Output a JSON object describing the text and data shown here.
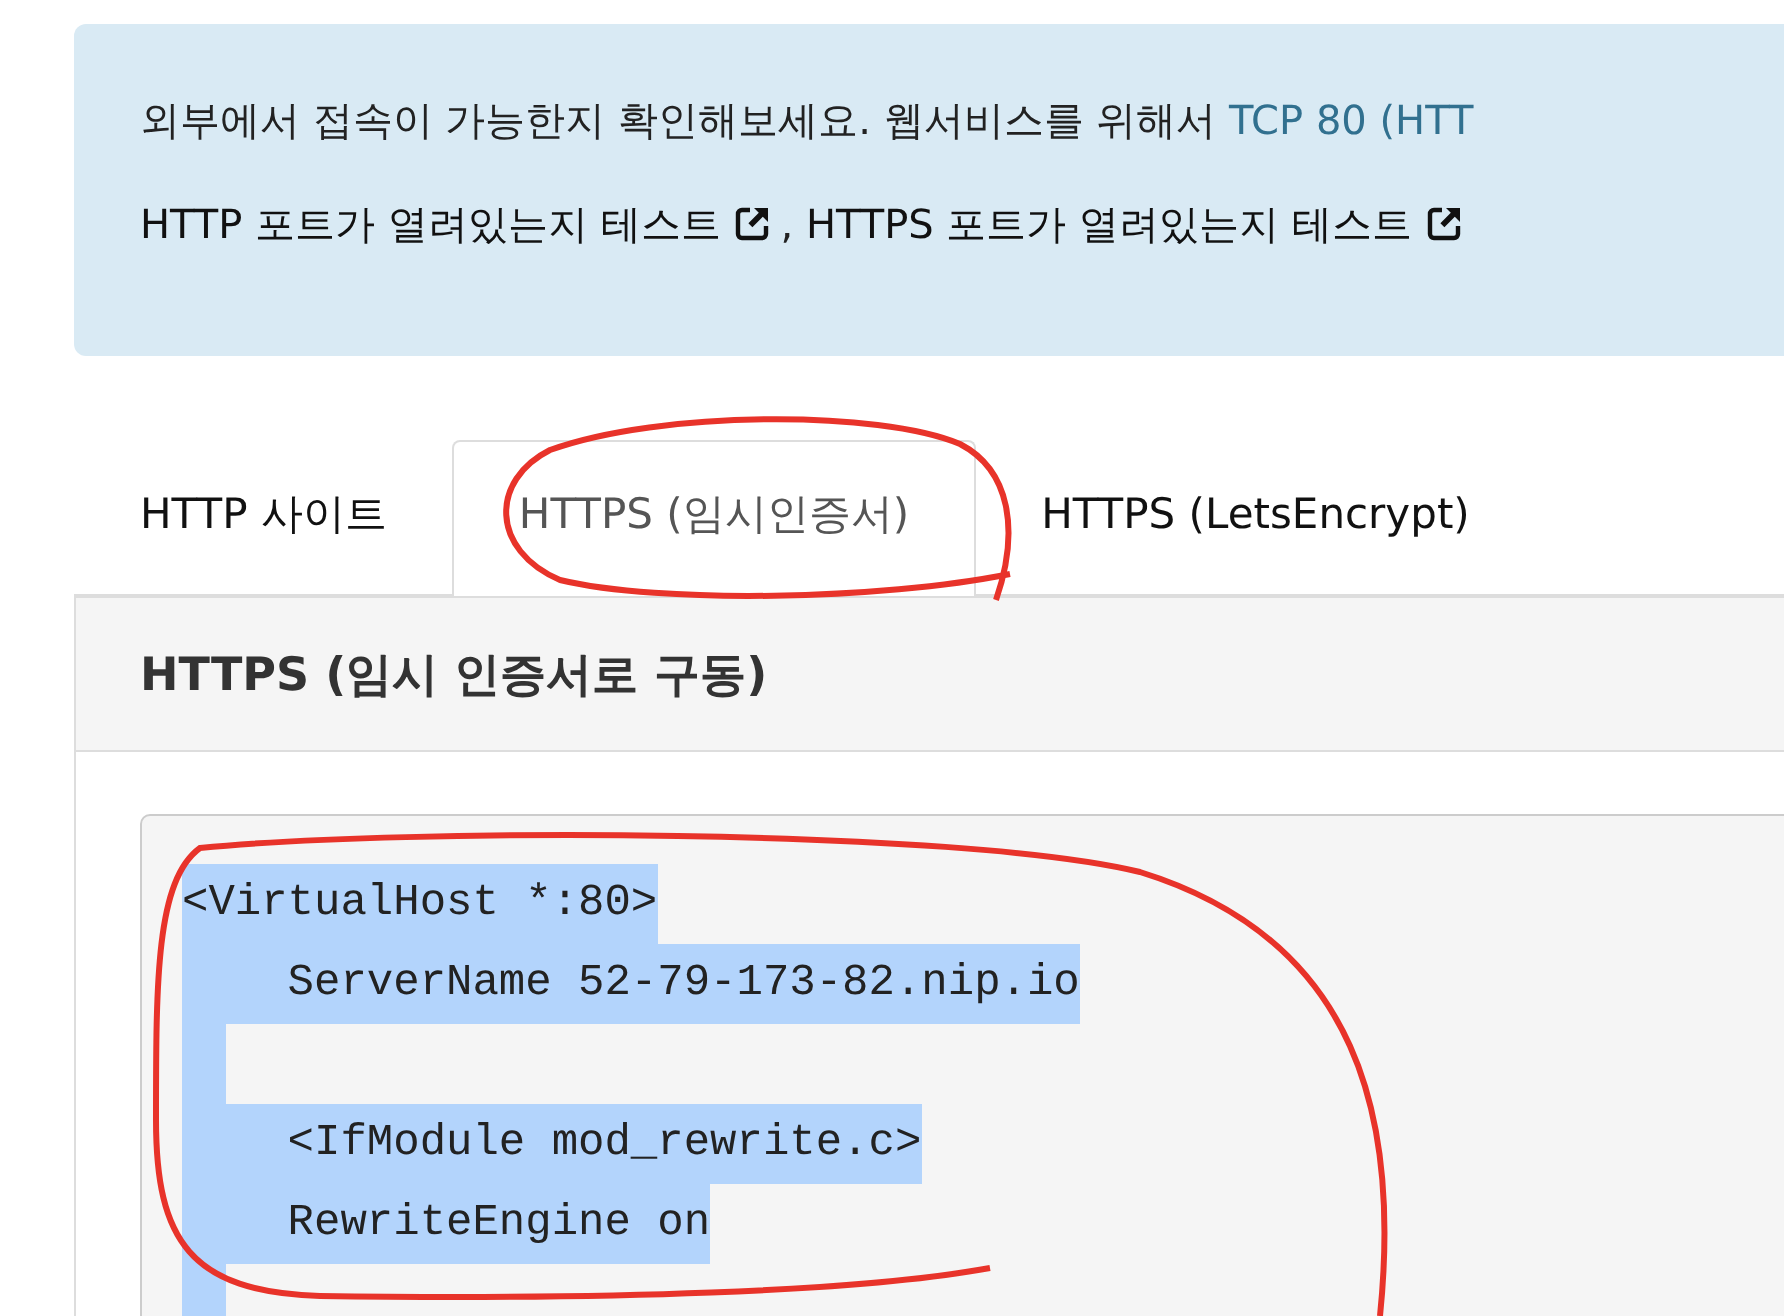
{
  "notice": {
    "text": "외부에서 접속이 가능한지 확인해보세요. 웹서비스를 위해서 ",
    "link": "TCP 80 (HTT",
    "tests": [
      {
        "label": "HTTP 포트가 열려있는지 테스트"
      },
      {
        "label": "HTTPS 포트가 열려있는지 테스트"
      }
    ],
    "separator": ", "
  },
  "tabs": [
    {
      "label": "HTTP 사이트",
      "selected": false
    },
    {
      "label": "HTTPS (임시인증서)",
      "selected": true
    },
    {
      "label": "HTTPS (LetsEncrypt)",
      "selected": false
    }
  ],
  "panel": {
    "title": "HTTPS (임시 인증서로 구동)",
    "code": {
      "selected": true,
      "lines": [
        {
          "kind": "text",
          "text": "<VirtualHost *:80>"
        },
        {
          "kind": "text",
          "text": "    ServerName 52-79-173-82.nip.io"
        },
        {
          "kind": "blank"
        },
        {
          "kind": "text",
          "text": "    <IfModule mod_rewrite.c>"
        },
        {
          "kind": "text",
          "text": "    RewriteEngine on"
        },
        {
          "kind": "blank"
        }
      ]
    }
  }
}
